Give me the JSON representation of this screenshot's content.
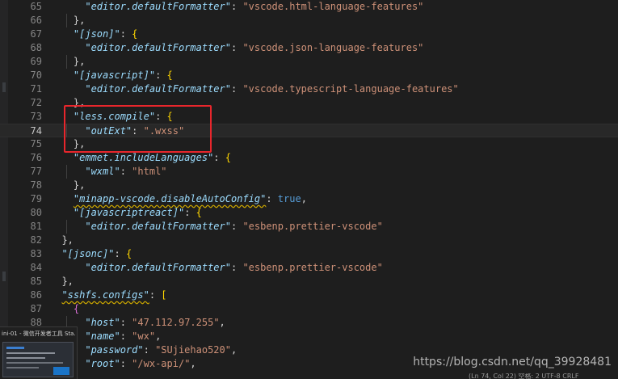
{
  "editor": {
    "lines": [
      {
        "num": "65",
        "tokens": [
          {
            "t": "      ",
            "c": "p"
          },
          {
            "t": "\"editor.defaultFormatter\"",
            "c": "k"
          },
          {
            "t": ": ",
            "c": "p"
          },
          {
            "t": "\"vscode.html-language-features\"",
            "c": "s"
          }
        ]
      },
      {
        "num": "66",
        "tokens": [
          {
            "t": "    ",
            "c": "p"
          },
          {
            "t": "},",
            "c": "p"
          }
        ]
      },
      {
        "num": "67",
        "tokens": [
          {
            "t": "    ",
            "c": "p"
          },
          {
            "t": "\"[json]\"",
            "c": "k"
          },
          {
            "t": ": ",
            "c": "p"
          },
          {
            "t": "{",
            "c": "br"
          }
        ]
      },
      {
        "num": "68",
        "tokens": [
          {
            "t": "      ",
            "c": "p"
          },
          {
            "t": "\"editor.defaultFormatter\"",
            "c": "k"
          },
          {
            "t": ": ",
            "c": "p"
          },
          {
            "t": "\"vscode.json-language-features\"",
            "c": "s"
          }
        ]
      },
      {
        "num": "69",
        "tokens": [
          {
            "t": "    ",
            "c": "p"
          },
          {
            "t": "},",
            "c": "p"
          }
        ]
      },
      {
        "num": "70",
        "tokens": [
          {
            "t": "    ",
            "c": "p"
          },
          {
            "t": "\"[javascript]\"",
            "c": "k"
          },
          {
            "t": ": ",
            "c": "p"
          },
          {
            "t": "{",
            "c": "br"
          }
        ]
      },
      {
        "num": "71",
        "tokens": [
          {
            "t": "      ",
            "c": "p"
          },
          {
            "t": "\"editor.defaultFormatter\"",
            "c": "k"
          },
          {
            "t": ": ",
            "c": "p"
          },
          {
            "t": "\"vscode.typescript-language-features\"",
            "c": "s"
          }
        ]
      },
      {
        "num": "72",
        "tokens": [
          {
            "t": "    ",
            "c": "p"
          },
          {
            "t": "},",
            "c": "p"
          }
        ]
      },
      {
        "num": "73",
        "tokens": [
          {
            "t": "    ",
            "c": "p"
          },
          {
            "t": "\"less.compile\"",
            "c": "k"
          },
          {
            "t": ": ",
            "c": "p"
          },
          {
            "t": "{",
            "c": "br"
          }
        ]
      },
      {
        "num": "74",
        "active": true,
        "tokens": [
          {
            "t": "      ",
            "c": "p"
          },
          {
            "t": "\"outExt\"",
            "c": "k"
          },
          {
            "t": ": ",
            "c": "p"
          },
          {
            "t": "\".wxss\"",
            "c": "s"
          }
        ]
      },
      {
        "num": "75",
        "tokens": [
          {
            "t": "    ",
            "c": "p"
          },
          {
            "t": "},",
            "c": "p"
          }
        ]
      },
      {
        "num": "76",
        "tokens": [
          {
            "t": "    ",
            "c": "p"
          },
          {
            "t": "\"emmet.includeLanguages\"",
            "c": "k"
          },
          {
            "t": ": ",
            "c": "p"
          },
          {
            "t": "{",
            "c": "br"
          }
        ]
      },
      {
        "num": "77",
        "tokens": [
          {
            "t": "      ",
            "c": "p"
          },
          {
            "t": "\"wxml\"",
            "c": "k"
          },
          {
            "t": ": ",
            "c": "p"
          },
          {
            "t": "\"html\"",
            "c": "s"
          }
        ]
      },
      {
        "num": "78",
        "tokens": [
          {
            "t": "    ",
            "c": "p"
          },
          {
            "t": "},",
            "c": "p"
          }
        ]
      },
      {
        "num": "79",
        "tokens": [
          {
            "t": "    ",
            "c": "p"
          },
          {
            "t": "\"minapp-vscode.disableAutoConfig\"",
            "c": "k sq"
          },
          {
            "t": ": ",
            "c": "p"
          },
          {
            "t": "true",
            "c": "kw"
          },
          {
            "t": ",",
            "c": "p"
          }
        ]
      },
      {
        "num": "80",
        "tokens": [
          {
            "t": "    ",
            "c": "p"
          },
          {
            "t": "\"[javascriptreact]\"",
            "c": "k"
          },
          {
            "t": ": ",
            "c": "p"
          },
          {
            "t": "{",
            "c": "br"
          }
        ]
      },
      {
        "num": "81",
        "tokens": [
          {
            "t": "      ",
            "c": "p"
          },
          {
            "t": "\"editor.defaultFormatter\"",
            "c": "k"
          },
          {
            "t": ": ",
            "c": "p"
          },
          {
            "t": "\"esbenp.prettier-vscode\"",
            "c": "s"
          }
        ]
      },
      {
        "num": "82",
        "tokens": [
          {
            "t": "  ",
            "c": "p"
          },
          {
            "t": "},",
            "c": "p"
          }
        ]
      },
      {
        "num": "83",
        "tokens": [
          {
            "t": "  ",
            "c": "p"
          },
          {
            "t": "\"[jsonc]\"",
            "c": "k"
          },
          {
            "t": ": ",
            "c": "p"
          },
          {
            "t": "{",
            "c": "br"
          }
        ]
      },
      {
        "num": "84",
        "tokens": [
          {
            "t": "      ",
            "c": "p"
          },
          {
            "t": "\"editor.defaultFormatter\"",
            "c": "k"
          },
          {
            "t": ": ",
            "c": "p"
          },
          {
            "t": "\"esbenp.prettier-vscode\"",
            "c": "s"
          }
        ]
      },
      {
        "num": "85",
        "tokens": [
          {
            "t": "  ",
            "c": "p"
          },
          {
            "t": "},",
            "c": "p"
          }
        ]
      },
      {
        "num": "86",
        "tokens": [
          {
            "t": "  ",
            "c": "p"
          },
          {
            "t": "\"sshfs.configs\"",
            "c": "k sq"
          },
          {
            "t": ": ",
            "c": "p"
          },
          {
            "t": "[",
            "c": "br"
          }
        ]
      },
      {
        "num": "87",
        "tokens": [
          {
            "t": "    ",
            "c": "p"
          },
          {
            "t": "{",
            "c": "b2"
          }
        ]
      },
      {
        "num": "88",
        "tokens": [
          {
            "t": "      ",
            "c": "p"
          },
          {
            "t": "\"host\"",
            "c": "k"
          },
          {
            "t": ": ",
            "c": "p"
          },
          {
            "t": "\"47.112.97.255\"",
            "c": "s"
          },
          {
            "t": ",",
            "c": "p"
          }
        ]
      },
      {
        "num": "89",
        "tokens": [
          {
            "t": "      ",
            "c": "p"
          },
          {
            "t": "\"name\"",
            "c": "k"
          },
          {
            "t": ": ",
            "c": "p"
          },
          {
            "t": "\"wx\"",
            "c": "s"
          },
          {
            "t": ",",
            "c": "p"
          }
        ]
      },
      {
        "num": "90",
        "tokens": [
          {
            "t": "      ",
            "c": "p"
          },
          {
            "t": "\"password\"",
            "c": "k"
          },
          {
            "t": ": ",
            "c": "p"
          },
          {
            "t": "\"SUjiehao520\"",
            "c": "s"
          },
          {
            "t": ",",
            "c": "p"
          }
        ]
      },
      {
        "num": "91",
        "tokens": [
          {
            "t": "      ",
            "c": "p"
          },
          {
            "t": "\"root\"",
            "c": "k"
          },
          {
            "t": ": ",
            "c": "p"
          },
          {
            "t": "\"/wx-api/\"",
            "c": "s"
          },
          {
            "t": ",",
            "c": "p"
          }
        ]
      }
    ]
  },
  "taskbar_thumbnail": {
    "title": "ini-01 - 微信开发者工具 Sta..."
  },
  "watermark": "https://blog.csdn.net/qq_39928481",
  "status_fragment": "(Ln 74, Col 22)  空格: 2  UTF-8  CRLF"
}
